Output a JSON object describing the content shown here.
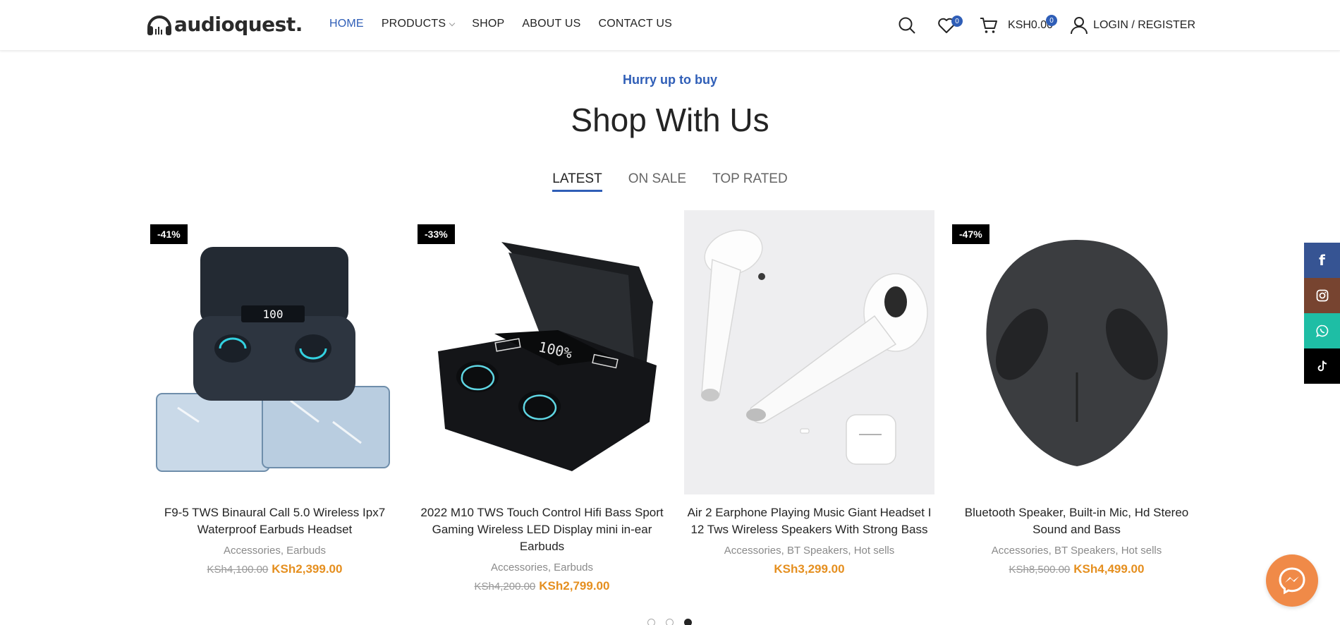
{
  "header": {
    "logo_text": "audioquest.",
    "nav": [
      {
        "label": "HOME",
        "active": true
      },
      {
        "label": "PRODUCTS",
        "dropdown": true
      },
      {
        "label": "SHOP"
      },
      {
        "label": "ABOUT US"
      },
      {
        "label": "CONTACT US"
      }
    ],
    "wishlist_count": "0",
    "cart_count": "0",
    "cart_total": "KSH0.00",
    "login_label": "LOGIN / REGISTER"
  },
  "section": {
    "eyebrow": "Hurry up to buy",
    "title": "Shop With Us",
    "tabs": [
      {
        "label": "LATEST",
        "active": true
      },
      {
        "label": "ON SALE"
      },
      {
        "label": "TOP RATED"
      }
    ]
  },
  "products": [
    {
      "badge": "-41%",
      "name": "F9-5 TWS Binaural Call 5.0 Wireless Ipx7 Waterproof Earbuds Headset",
      "categories": "Accessories, Earbuds",
      "old_price": "KSh4,100.00",
      "price": "KSh2,399.00"
    },
    {
      "badge": "-33%",
      "name": "2022 M10 TWS Touch Control Hifi Bass Sport Gaming Wireless LED Display mini in-ear Earbuds",
      "categories": "Accessories, Earbuds",
      "old_price": "KSh4,200.00",
      "price": "KSh2,799.00"
    },
    {
      "badge": "",
      "name": "Air 2 Earphone Playing Music Giant Headset I 12 Tws Wireless Speakers With Strong Bass",
      "categories": "Accessories, BT Speakers, Hot sells",
      "old_price": "",
      "price": "KSh3,299.00"
    },
    {
      "badge": "-47%",
      "name": "Bluetooth Speaker, Built-in Mic, Hd Stereo Sound and Bass",
      "categories": "Accessories, BT Speakers, Hot sells",
      "old_price": "KSh8,500.00",
      "price": "KSh4,499.00"
    }
  ],
  "social": [
    {
      "icon": "facebook-icon",
      "glyph": "f",
      "color": "#365493"
    },
    {
      "icon": "instagram-icon",
      "glyph": "◎",
      "color": "#774430"
    },
    {
      "icon": "whatsapp-icon",
      "glyph": "✆",
      "color": "#1ebea5"
    },
    {
      "icon": "tiktok-icon",
      "glyph": "♪",
      "color": "#000000"
    }
  ],
  "colors": {
    "accent": "#2f5eb7",
    "price": "#e58f1f",
    "messenger": "#f08a48"
  }
}
